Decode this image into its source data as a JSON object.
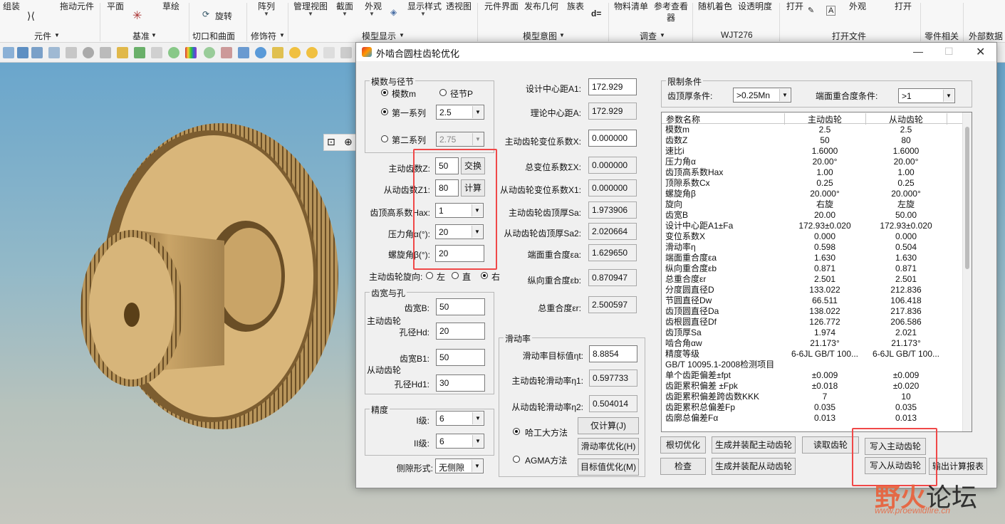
{
  "ribbon": {
    "items": [
      "组装",
      "拖动元件",
      "平面",
      "草绘",
      "旋转",
      "阵列",
      "管理视图",
      "截面",
      "外观",
      "显示样式",
      "透视图",
      "元件界面",
      "发布几何",
      "族表",
      "d=",
      "物料清单",
      "参考查看",
      "器",
      "随机着色",
      "设透明度",
      "打开",
      "外观",
      "打开"
    ],
    "groups": [
      "元件",
      "基准",
      "切口和曲面",
      "修饰符",
      "模型显示",
      "模型意图",
      "调查",
      "WJT276",
      "打开文件",
      "零件相关",
      "外部数据"
    ]
  },
  "dialog": {
    "title": "外啮合圆柱齿轮优化",
    "module_group": {
      "title": "模数与径节",
      "radio_module": "模数m",
      "radio_pitch": "径节P",
      "radio_series1": "第一系列",
      "series1_value": "2.5",
      "radio_series2": "第二系列",
      "series2_value": "2.75"
    },
    "params": {
      "z1_label": "主动齿数Z:",
      "z1_value": "50",
      "swap_button": "交换",
      "z2_label": "从动齿数Z1:",
      "z2_value": "80",
      "calc_button": "计算",
      "hax_label": "齿顶高系数Hax:",
      "hax_value": "1",
      "alpha_label": "压力角α(°):",
      "alpha_value": "20",
      "beta_label": "螺旋角β(°):",
      "beta_value": "20",
      "hand_label": "主动齿轮旋向:",
      "hand_left": "左",
      "hand_straight": "直",
      "hand_right": "右"
    },
    "width_group": {
      "title": "齿宽与孔",
      "driver_label": "主动齿轮",
      "b_label": "齿宽B:",
      "b_value": "50",
      "hd_label": "孔径Hd:",
      "hd_value": "20",
      "driven_label": "从动齿轮",
      "b1_label": "齿宽B1:",
      "b1_value": "50",
      "hd1_label": "孔径Hd1:",
      "hd1_value": "30"
    },
    "precision_group": {
      "title": "精度",
      "grade1_label": "I级:",
      "grade1_value": "6",
      "grade2_label": "II级:",
      "grade2_value": "6"
    },
    "backlash": {
      "label": "侧隙形式:",
      "value": "无侧隙"
    },
    "results": {
      "a1_label": "设计中心距A1:",
      "a1_value": "172.929",
      "a_label": "理论中心距A:",
      "a_value": "172.929",
      "x_label": "主动齿轮变位系数X:",
      "x_value": "0.000000",
      "sx_label": "总变位系数ΣX:",
      "sx_value": "0.000000",
      "x1_label": "从动齿轮变位系数X1:",
      "x1_value": "0.000000",
      "sa_label": "主动齿轮齿顶厚Sa:",
      "sa_value": "1.973906",
      "sa2_label": "从动齿轮齿顶厚Sa2:",
      "sa2_value": "2.020664",
      "ea_label": "端面重合度εa:",
      "ea_value": "1.629650",
      "eb_label": "纵向重合度εb:",
      "eb_value": "0.870947",
      "er_label": "总重合度εr:",
      "er_value": "2.500597"
    },
    "slide_group": {
      "title": "滑动率",
      "target_label": "滑动率目标值ηt:",
      "target_value": "8.8854",
      "n1_label": "主动齿轮滑动率η1:",
      "n1_value": "0.597733",
      "n2_label": "从动齿轮滑动率η2:",
      "n2_value": "0.504014",
      "method_hit": "哈工大方法",
      "method_agma": "AGMA方法",
      "btn_calc": "仅计算(J)",
      "btn_slide_opt": "滑动率优化(H)",
      "btn_target_opt": "目标值优化(M)"
    },
    "limits": {
      "title": "限制条件",
      "tip_label": "齿顶厚条件:",
      "tip_value": ">0.25Mn",
      "ea_label": "端面重合度条件:",
      "ea_value": ">1"
    },
    "table": {
      "headers": [
        "参数名称",
        "主动齿轮",
        "从动齿轮"
      ],
      "rows": [
        [
          "模数m",
          "2.5",
          "2.5"
        ],
        [
          "齿数Z",
          "50",
          "80"
        ],
        [
          "速比i",
          "1.6000",
          "1.6000"
        ],
        [
          "压力角α",
          "20.00°",
          "20.00°"
        ],
        [
          "齿顶高系数Hax",
          "1.00",
          "1.00"
        ],
        [
          "顶隙系数Cx",
          "0.25",
          "0.25"
        ],
        [
          "螺旋角β",
          "20.000°",
          "20.000°"
        ],
        [
          "旋向",
          "右旋",
          "左旋"
        ],
        [
          "齿宽B",
          "20.00",
          "50.00"
        ],
        [
          "设计中心距A1±Fa",
          "172.93±0.020",
          "172.93±0.020"
        ],
        [
          "变位系数X",
          "0.000",
          "0.000"
        ],
        [
          "滑动率η",
          "0.598",
          "0.504"
        ],
        [
          "端面重合度εa",
          "1.630",
          "1.630"
        ],
        [
          "纵向重合度εb",
          "0.871",
          "0.871"
        ],
        [
          "总重合度εr",
          "2.501",
          "2.501"
        ],
        [
          "分度圆直径D",
          "133.022",
          "212.836"
        ],
        [
          "节圆直径Dw",
          "66.511",
          "106.418"
        ],
        [
          "齿顶圆直径Da",
          "138.022",
          "217.836"
        ],
        [
          "齿根圆直径Df",
          "126.772",
          "206.586"
        ],
        [
          "齿顶厚Sa",
          "1.974",
          "2.021"
        ],
        [
          "啮合角αw",
          "21.173°",
          "21.173°"
        ],
        [
          "精度等级",
          "6-6JL GB/T 100...",
          "6-6JL GB/T 100..."
        ],
        [
          "GB/T 10095.1-2008检测项目",
          "",
          ""
        ],
        [
          "单个齿距偏差±fpt",
          "±0.009",
          "±0.009"
        ],
        [
          "齿距累积偏差 ±Fpk",
          "±0.018",
          "±0.020"
        ],
        [
          "齿距累积偏差跨齿数KKK",
          "7",
          "10"
        ],
        [
          "齿距累积总偏差Fp",
          "0.035",
          "0.035"
        ],
        [
          "齿廓总偏差Fα",
          "0.013",
          "0.013"
        ]
      ]
    },
    "buttons": {
      "root_cut": "根切优化",
      "gen_driver": "生成并装配主动齿轮",
      "read_gear": "读取齿轮",
      "write_driver": "写入主动齿轮",
      "check": "检查",
      "gen_driven": "生成并装配从动齿轮",
      "write_driven": "写入从动齿轮",
      "export_report": "输出计算报表"
    }
  },
  "watermark": {
    "text_a": "野火",
    "text_b": "论坛",
    "url": "www.proewildfire.cn"
  },
  "colors": {
    "highlight": "#f04848",
    "viewport_top": "#6aa6cc",
    "gear": "#c9a467"
  }
}
